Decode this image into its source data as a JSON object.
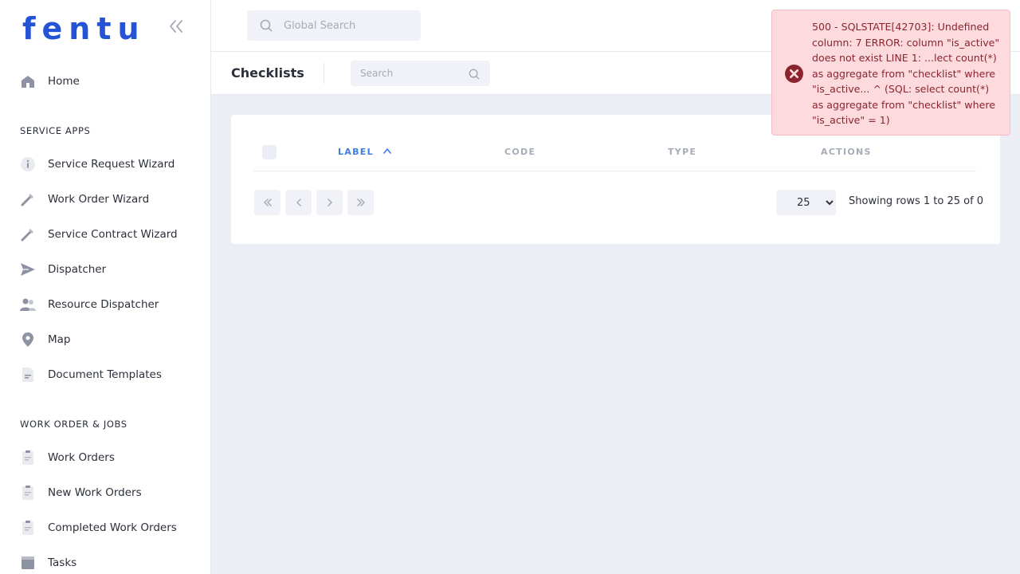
{
  "app": {
    "logo_text": "fentu",
    "brand_color": "#2453d6"
  },
  "sidebar": {
    "top_items": [
      {
        "label": "Home",
        "icon": "home-icon"
      }
    ],
    "sections": [
      {
        "title": "SERVICE APPS",
        "items": [
          {
            "label": "Service Request Wizard",
            "icon": "info-icon"
          },
          {
            "label": "Work Order Wizard",
            "icon": "wrench-icon"
          },
          {
            "label": "Service Contract Wizard",
            "icon": "wrench-icon"
          },
          {
            "label": "Dispatcher",
            "icon": "send-icon"
          },
          {
            "label": "Resource Dispatcher",
            "icon": "people-icon"
          },
          {
            "label": "Map",
            "icon": "map-pin-icon"
          },
          {
            "label": "Document Templates",
            "icon": "document-icon"
          }
        ]
      },
      {
        "title": "WORK ORDER & JOBS",
        "items": [
          {
            "label": "Work Orders",
            "icon": "clipboard-icon"
          },
          {
            "label": "New Work Orders",
            "icon": "clipboard-icon"
          },
          {
            "label": "Completed Work Orders",
            "icon": "clipboard-icon"
          },
          {
            "label": "Tasks",
            "icon": "tasks-icon"
          }
        ]
      }
    ]
  },
  "header": {
    "global_search_placeholder": "Global Search"
  },
  "page": {
    "title": "Checklists",
    "search_placeholder": "Search"
  },
  "table": {
    "columns": [
      {
        "label": "LABEL",
        "sorted": "asc"
      },
      {
        "label": "CODE"
      },
      {
        "label": "TYPE"
      },
      {
        "label": "ACTIONS"
      }
    ],
    "rows": [],
    "rows_per_page": "25",
    "rows_per_page_options": [
      "25"
    ],
    "rows_info": "Showing rows 1 to 25 of 0"
  },
  "toast": {
    "type": "error",
    "icon": "error-circle-icon",
    "message": "500 - SQLSTATE[42703]: Undefined column: 7 ERROR: column \"is_active\" does not exist LINE 1: ...lect count(*) as aggregate from \"checklist\" where \"is_active... ^ (SQL: select count(*) as aggregate from \"checklist\" where \"is_active\" = 1)",
    "color": "#8a2530"
  }
}
